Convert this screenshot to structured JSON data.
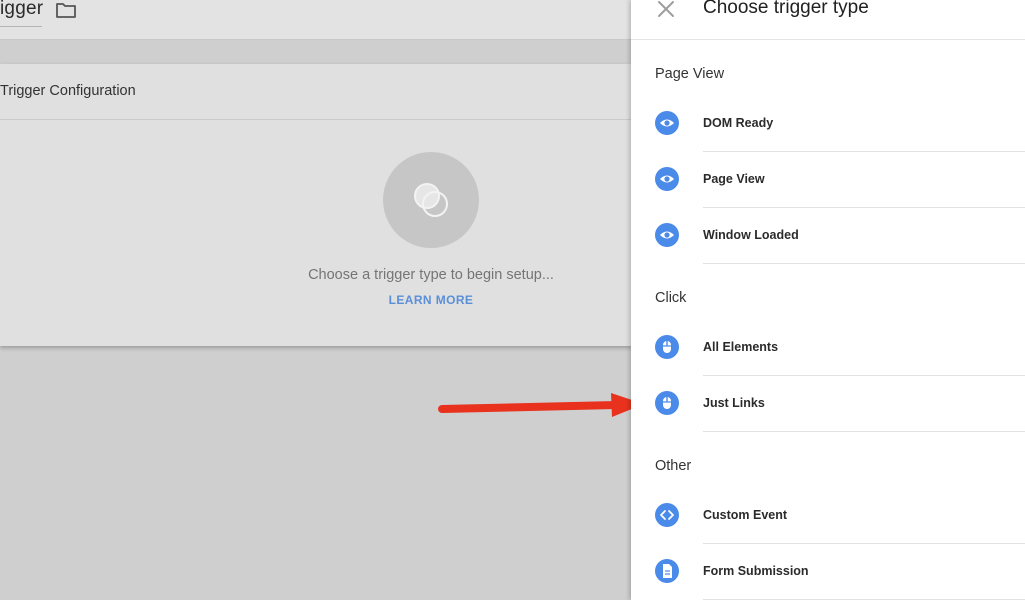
{
  "editor": {
    "trigger_name": "igger",
    "config_title": "Trigger Configuration",
    "placeholder_text": "Choose a trigger type to begin setup...",
    "learn_more": "LEARN MORE"
  },
  "panel": {
    "title": "Choose trigger type",
    "sections": [
      {
        "title": "Page View",
        "items": [
          {
            "label": "DOM Ready",
            "icon": "eye-icon"
          },
          {
            "label": "Page View",
            "icon": "eye-icon"
          },
          {
            "label": "Window Loaded",
            "icon": "eye-icon"
          }
        ]
      },
      {
        "title": "Click",
        "items": [
          {
            "label": "All Elements",
            "icon": "mouse-icon"
          },
          {
            "label": "Just Links",
            "icon": "mouse-icon"
          }
        ]
      },
      {
        "title": "Other",
        "items": [
          {
            "label": "Custom Event",
            "icon": "code-icon"
          },
          {
            "label": "Form Submission",
            "icon": "document-icon"
          }
        ]
      }
    ]
  },
  "colors": {
    "accent": "#4a8ae8",
    "link": "#5b8fd8",
    "arrow": "#e8321e",
    "overlay": "#cfcfcf"
  }
}
